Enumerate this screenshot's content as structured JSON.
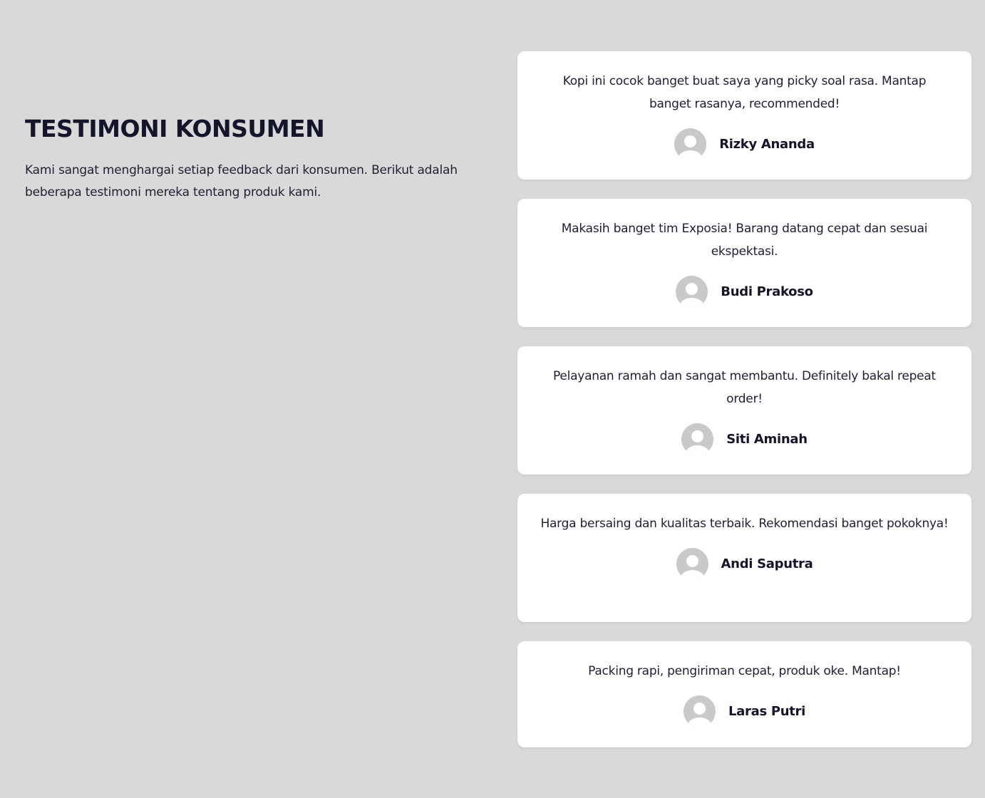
{
  "section": {
    "title": "TESTIMONI KONSUMEN",
    "description": "Kami sangat menghargai setiap feedback dari konsumen. Berikut adalah beberapa testimoni mereka tentang produk kami."
  },
  "testimonials": [
    {
      "quote": "Kopi ini cocok banget buat saya yang picky soal rasa. Mantap banget rasanya, recommended!",
      "name": "Rizky Ananda",
      "avatar_icon": "user-avatar-icon"
    },
    {
      "quote": "Makasih banget tim Exposia! Barang datang cepat dan sesuai ekspektasi.",
      "name": "Budi Prakoso",
      "avatar_icon": "user-avatar-icon"
    },
    {
      "quote": "Pelayanan ramah dan sangat membantu. Definitely bakal repeat order!",
      "name": "Siti Aminah",
      "avatar_icon": "user-avatar-icon"
    },
    {
      "quote": "Harga bersaing dan kualitas terbaik. Rekomendasi banget pokoknya!",
      "name": "Andi Saputra",
      "avatar_icon": "user-avatar-icon"
    },
    {
      "quote": "Packing rapi, pengiriman cepat, produk oke. Mantap!",
      "name": "Laras Putri",
      "avatar_icon": "user-avatar-icon"
    }
  ],
  "colors": {
    "background": "#d9d9d9",
    "card": "#ffffff",
    "text_dark": "#14142b",
    "avatar": "#c9c9c9"
  }
}
